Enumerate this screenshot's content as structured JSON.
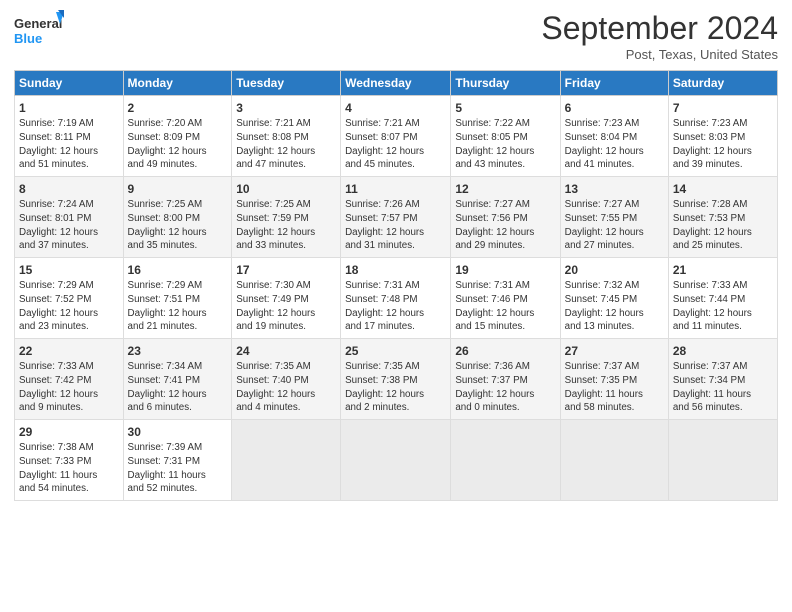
{
  "header": {
    "logo_line1": "General",
    "logo_line2": "Blue",
    "month_title": "September 2024",
    "location": "Post, Texas, United States"
  },
  "weekdays": [
    "Sunday",
    "Monday",
    "Tuesday",
    "Wednesday",
    "Thursday",
    "Friday",
    "Saturday"
  ],
  "weeks": [
    [
      {
        "day": "1",
        "info": "Sunrise: 7:19 AM\nSunset: 8:11 PM\nDaylight: 12 hours\nand 51 minutes."
      },
      {
        "day": "2",
        "info": "Sunrise: 7:20 AM\nSunset: 8:09 PM\nDaylight: 12 hours\nand 49 minutes."
      },
      {
        "day": "3",
        "info": "Sunrise: 7:21 AM\nSunset: 8:08 PM\nDaylight: 12 hours\nand 47 minutes."
      },
      {
        "day": "4",
        "info": "Sunrise: 7:21 AM\nSunset: 8:07 PM\nDaylight: 12 hours\nand 45 minutes."
      },
      {
        "day": "5",
        "info": "Sunrise: 7:22 AM\nSunset: 8:05 PM\nDaylight: 12 hours\nand 43 minutes."
      },
      {
        "day": "6",
        "info": "Sunrise: 7:23 AM\nSunset: 8:04 PM\nDaylight: 12 hours\nand 41 minutes."
      },
      {
        "day": "7",
        "info": "Sunrise: 7:23 AM\nSunset: 8:03 PM\nDaylight: 12 hours\nand 39 minutes."
      }
    ],
    [
      {
        "day": "8",
        "info": "Sunrise: 7:24 AM\nSunset: 8:01 PM\nDaylight: 12 hours\nand 37 minutes."
      },
      {
        "day": "9",
        "info": "Sunrise: 7:25 AM\nSunset: 8:00 PM\nDaylight: 12 hours\nand 35 minutes."
      },
      {
        "day": "10",
        "info": "Sunrise: 7:25 AM\nSunset: 7:59 PM\nDaylight: 12 hours\nand 33 minutes."
      },
      {
        "day": "11",
        "info": "Sunrise: 7:26 AM\nSunset: 7:57 PM\nDaylight: 12 hours\nand 31 minutes."
      },
      {
        "day": "12",
        "info": "Sunrise: 7:27 AM\nSunset: 7:56 PM\nDaylight: 12 hours\nand 29 minutes."
      },
      {
        "day": "13",
        "info": "Sunrise: 7:27 AM\nSunset: 7:55 PM\nDaylight: 12 hours\nand 27 minutes."
      },
      {
        "day": "14",
        "info": "Sunrise: 7:28 AM\nSunset: 7:53 PM\nDaylight: 12 hours\nand 25 minutes."
      }
    ],
    [
      {
        "day": "15",
        "info": "Sunrise: 7:29 AM\nSunset: 7:52 PM\nDaylight: 12 hours\nand 23 minutes."
      },
      {
        "day": "16",
        "info": "Sunrise: 7:29 AM\nSunset: 7:51 PM\nDaylight: 12 hours\nand 21 minutes."
      },
      {
        "day": "17",
        "info": "Sunrise: 7:30 AM\nSunset: 7:49 PM\nDaylight: 12 hours\nand 19 minutes."
      },
      {
        "day": "18",
        "info": "Sunrise: 7:31 AM\nSunset: 7:48 PM\nDaylight: 12 hours\nand 17 minutes."
      },
      {
        "day": "19",
        "info": "Sunrise: 7:31 AM\nSunset: 7:46 PM\nDaylight: 12 hours\nand 15 minutes."
      },
      {
        "day": "20",
        "info": "Sunrise: 7:32 AM\nSunset: 7:45 PM\nDaylight: 12 hours\nand 13 minutes."
      },
      {
        "day": "21",
        "info": "Sunrise: 7:33 AM\nSunset: 7:44 PM\nDaylight: 12 hours\nand 11 minutes."
      }
    ],
    [
      {
        "day": "22",
        "info": "Sunrise: 7:33 AM\nSunset: 7:42 PM\nDaylight: 12 hours\nand 9 minutes."
      },
      {
        "day": "23",
        "info": "Sunrise: 7:34 AM\nSunset: 7:41 PM\nDaylight: 12 hours\nand 6 minutes."
      },
      {
        "day": "24",
        "info": "Sunrise: 7:35 AM\nSunset: 7:40 PM\nDaylight: 12 hours\nand 4 minutes."
      },
      {
        "day": "25",
        "info": "Sunrise: 7:35 AM\nSunset: 7:38 PM\nDaylight: 12 hours\nand 2 minutes."
      },
      {
        "day": "26",
        "info": "Sunrise: 7:36 AM\nSunset: 7:37 PM\nDaylight: 12 hours\nand 0 minutes."
      },
      {
        "day": "27",
        "info": "Sunrise: 7:37 AM\nSunset: 7:35 PM\nDaylight: 11 hours\nand 58 minutes."
      },
      {
        "day": "28",
        "info": "Sunrise: 7:37 AM\nSunset: 7:34 PM\nDaylight: 11 hours\nand 56 minutes."
      }
    ],
    [
      {
        "day": "29",
        "info": "Sunrise: 7:38 AM\nSunset: 7:33 PM\nDaylight: 11 hours\nand 54 minutes."
      },
      {
        "day": "30",
        "info": "Sunrise: 7:39 AM\nSunset: 7:31 PM\nDaylight: 11 hours\nand 52 minutes."
      },
      {
        "day": "",
        "info": ""
      },
      {
        "day": "",
        "info": ""
      },
      {
        "day": "",
        "info": ""
      },
      {
        "day": "",
        "info": ""
      },
      {
        "day": "",
        "info": ""
      }
    ]
  ]
}
